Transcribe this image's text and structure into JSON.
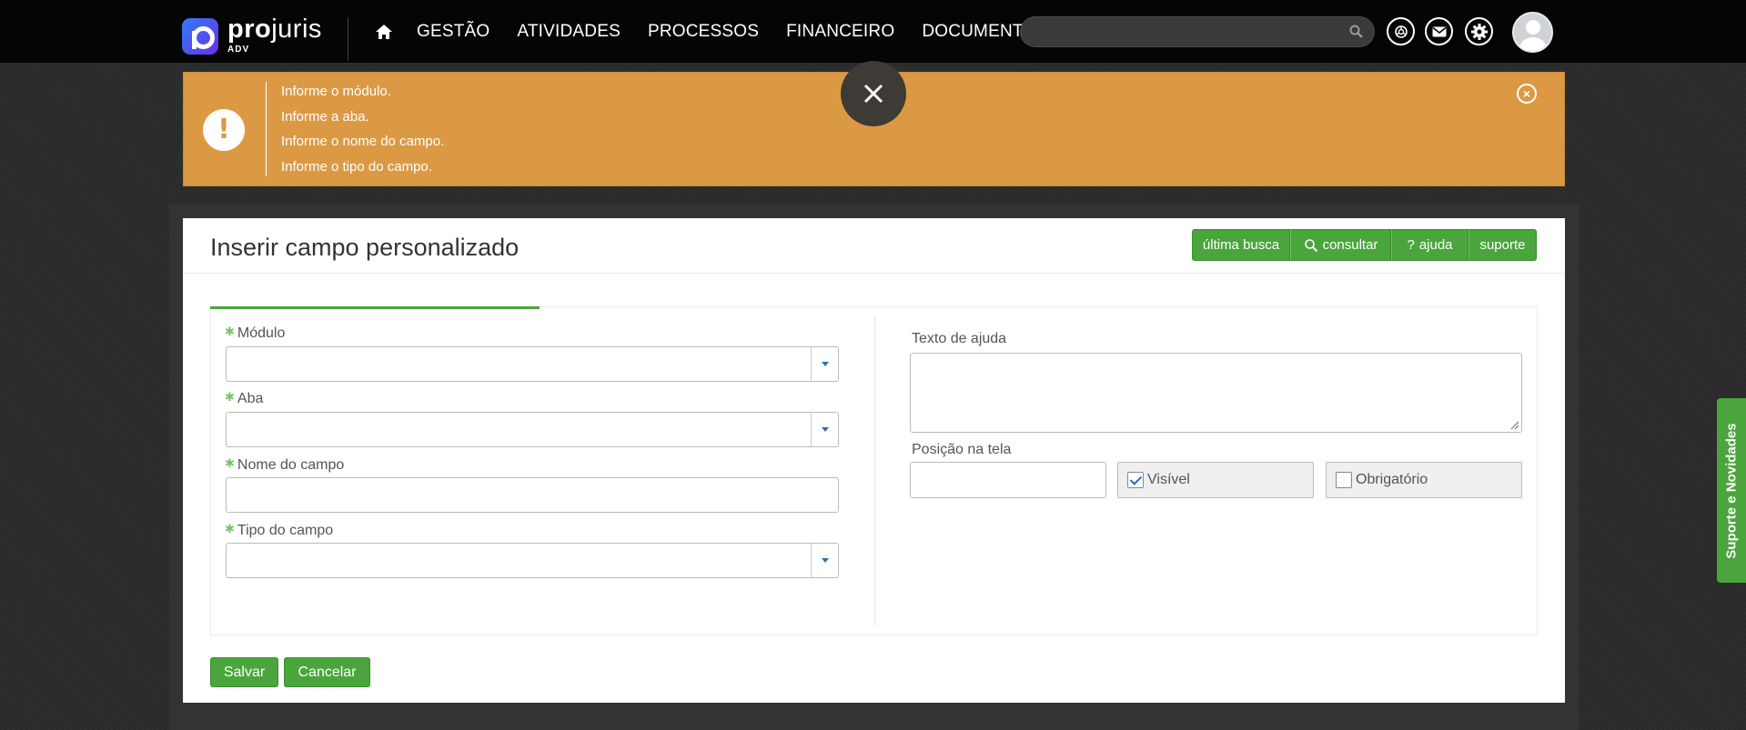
{
  "brand": {
    "name_bold": "pro",
    "name_light": "juris",
    "sub": "ADV"
  },
  "nav": {
    "items": [
      "GESTÃO",
      "ATIVIDADES",
      "PROCESSOS",
      "FINANCEIRO",
      "DOCUMENTOS"
    ]
  },
  "search": {
    "placeholder": ""
  },
  "alert": {
    "messages": [
      "Informe o módulo.",
      "Informe a aba.",
      "Informe o nome do campo.",
      "Informe o tipo do campo."
    ],
    "icon": "exclamation-icon",
    "color": "#dc9944"
  },
  "page": {
    "title": "Inserir campo personalizado",
    "buttons": {
      "last_search": "última busca",
      "consult": "consultar",
      "help": "ajuda",
      "support": "suporte"
    }
  },
  "form": {
    "modulo_label": "Módulo",
    "aba_label": "Aba",
    "nome_label": "Nome do campo",
    "tipo_label": "Tipo do campo",
    "help_text_label": "Texto de ajuda",
    "position_label": "Posição na tela",
    "visible_label": "Visível",
    "visible_checked": true,
    "required_label": "Obrigatório",
    "required_checked": false,
    "required_marker": "✱"
  },
  "actions": {
    "save": "Salvar",
    "cancel": "Cancelar"
  },
  "side_tab": {
    "label": "Suporte e Novidades"
  },
  "colors": {
    "accent": "#4aa53c",
    "warning": "#dc9944",
    "topbar": "#050505"
  }
}
